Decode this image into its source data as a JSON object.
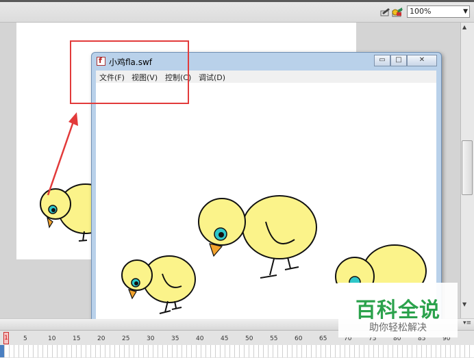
{
  "toolbar": {
    "zoom_value": "100%",
    "icons": [
      "edit-symbols-icon",
      "edit-scene-icon",
      "zoom-dropdown-arrow-icon"
    ]
  },
  "swf_window": {
    "title": "小鸡fla.swf",
    "menu": [
      "文件(F)",
      "视图(V)",
      "控制(C)",
      "调试(D)"
    ],
    "controls": [
      "minimize",
      "maximize",
      "close"
    ]
  },
  "timeline": {
    "current_frame": "1",
    "ruler_ticks": [
      "5",
      "10",
      "15",
      "20",
      "25",
      "30",
      "35",
      "40",
      "45",
      "50",
      "55",
      "60",
      "65",
      "70",
      "75",
      "80",
      "85",
      "90"
    ]
  },
  "watermark": {
    "title": "百科全说",
    "subtitle": "助你轻松解决"
  },
  "colors": {
    "highlight": "#e23a3a",
    "chick_body": "#fbf38a",
    "chick_eye": "#2ec7c9",
    "beak": "#f2a22c",
    "watermark_green": "#2ba24c"
  }
}
